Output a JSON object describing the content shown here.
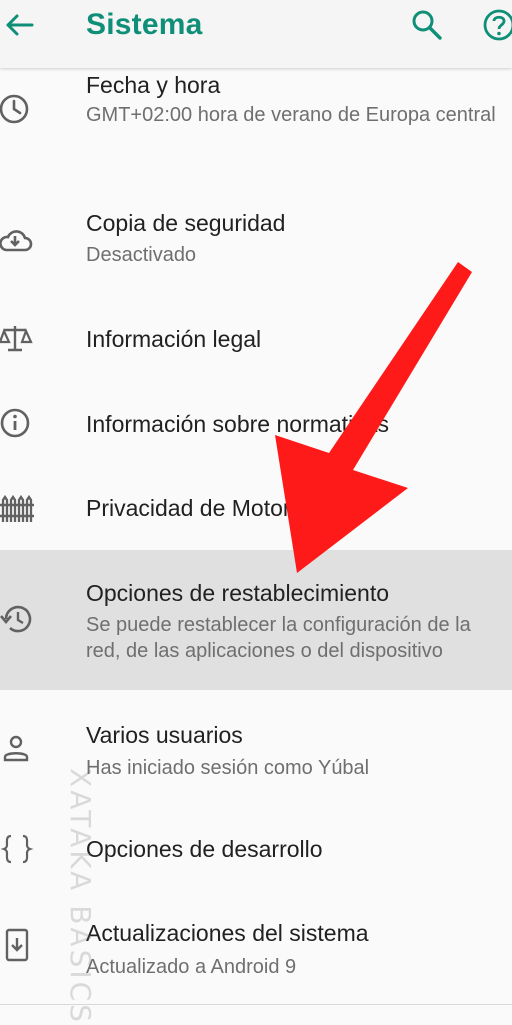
{
  "appbar": {
    "title": "Sistema"
  },
  "items": [
    {
      "title": "Fecha y hora",
      "subtitle": "GMT+02:00 hora de verano de Europa central",
      "icon": "clock-icon"
    },
    {
      "title": "Copia de seguridad",
      "subtitle": "Desactivado",
      "icon": "cloud-download-icon"
    },
    {
      "title": "Información legal",
      "subtitle": "",
      "icon": "scales-icon"
    },
    {
      "title": "Información sobre normativas",
      "subtitle": "",
      "icon": "info-icon"
    },
    {
      "title": "Privacidad de Motorola",
      "subtitle": "",
      "icon": "fence-icon"
    },
    {
      "title": "Opciones de restablecimiento",
      "subtitle": "Se puede restablecer la configuración de la red, de las aplicaciones o del dispositivo",
      "icon": "history-icon"
    },
    {
      "title": "Varios usuarios",
      "subtitle": "Has iniciado sesión como Yúbal",
      "icon": "person-icon"
    },
    {
      "title": "Opciones de desarrollo",
      "subtitle": "",
      "icon": "braces-icon"
    },
    {
      "title": "Actualizaciones del sistema",
      "subtitle": "Actualizado a Android 9",
      "icon": "system-update-icon"
    }
  ],
  "watermark": "XATAKA BASICS",
  "colors": {
    "accent": "#0f8f78",
    "arrow": "#ff1a1a",
    "highlight": "#e0e0e0"
  }
}
